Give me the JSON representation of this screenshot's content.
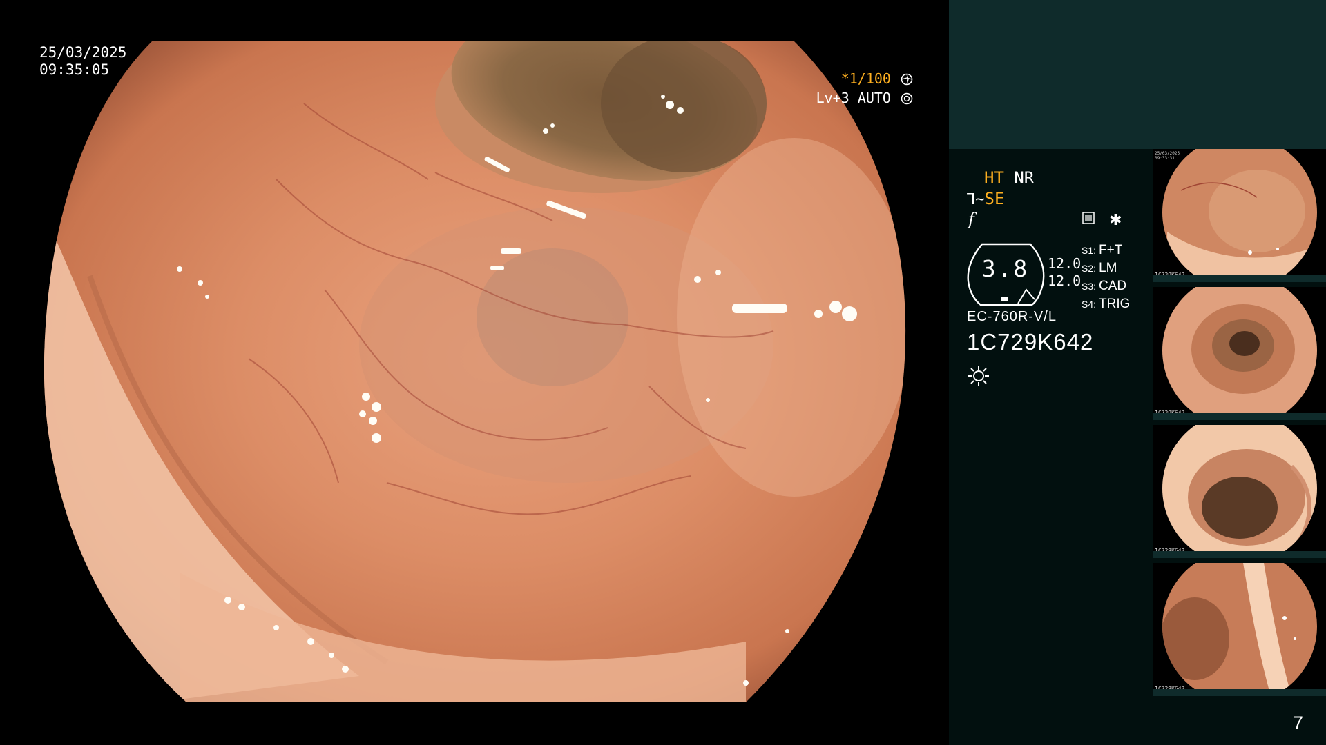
{
  "overlay": {
    "date": "25/03/2025",
    "time": "09:35:05",
    "shutter": "*1/100",
    "light_level": "Lv+3 AUTO"
  },
  "panel": {
    "ht": "HT",
    "nr": "NR",
    "se": "SE",
    "gauge_value": "3.8",
    "gauge_right_top": "12.0",
    "gauge_right_bottom": "12.0",
    "slots": [
      {
        "label": "S1:",
        "value": "F+T"
      },
      {
        "label": "S2:",
        "value": "LM"
      },
      {
        "label": "S3:",
        "value": "CAD"
      },
      {
        "label": "S4:",
        "value": "TRIG"
      }
    ],
    "scope_model": "EC-760R-V/L",
    "scope_serial": "1C729K642",
    "accent_color": "#ffb020",
    "icons": [
      "scissors-se-icon",
      "f-number-icon",
      "memo-icon",
      "asterisk-icon",
      "lamp-icon"
    ]
  },
  "thumbnails": [
    {
      "tag": "1C729K642",
      "index": "1"
    },
    {
      "tag": "1C729K642",
      "index": "2"
    },
    {
      "tag": "1C729K642",
      "index": "3"
    },
    {
      "tag": "1C729K642",
      "index": "4"
    }
  ],
  "page_number": "7"
}
